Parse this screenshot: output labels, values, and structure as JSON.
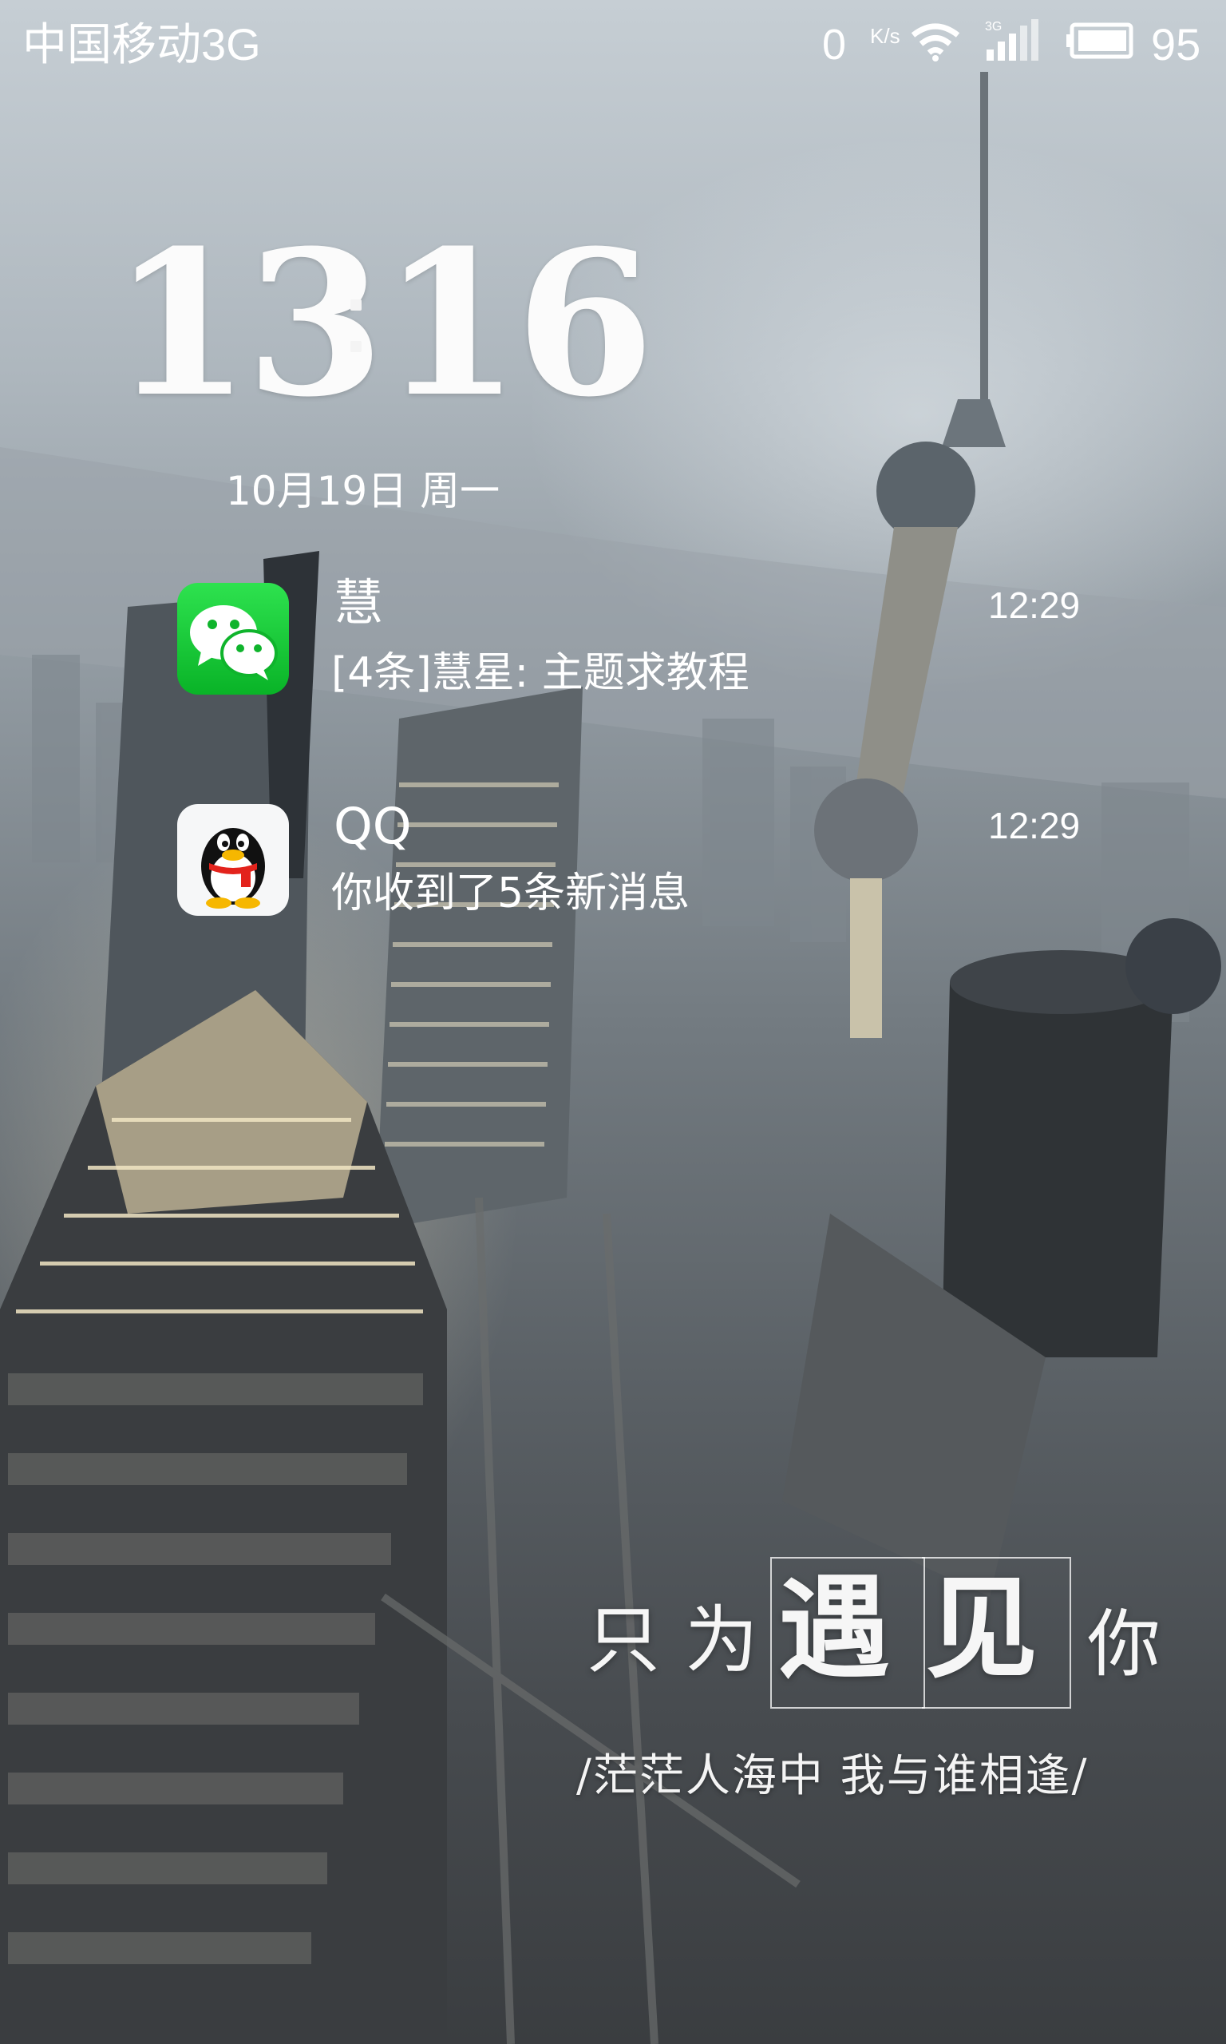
{
  "status_bar": {
    "carrier": "中国移动3G",
    "net_speed_value": "0",
    "net_speed_unit": "K/s",
    "signal_label": "3G",
    "battery_percent": "95",
    "icons": [
      "wifi-icon",
      "signal-icon",
      "battery-icon"
    ]
  },
  "clock": {
    "hour": "13",
    "minute": "16",
    "date": "10月19日  周一"
  },
  "notifications": [
    {
      "app_icon": "wechat-icon",
      "title": "慧",
      "message": "[4条]慧星: 主题求教程",
      "time": "12:29",
      "icon_color": "#1fcc3c"
    },
    {
      "app_icon": "qq-penguin-icon",
      "title": "QQ",
      "message": "你收到了5条新消息",
      "time": "12:29",
      "icon_color": "#f6f7f8"
    }
  ],
  "wallpaper": {
    "slogan_chars": [
      "只",
      "为",
      "遇",
      "见",
      "你"
    ],
    "slogan_sub": "/茫茫人海中 我与谁相逢/"
  }
}
